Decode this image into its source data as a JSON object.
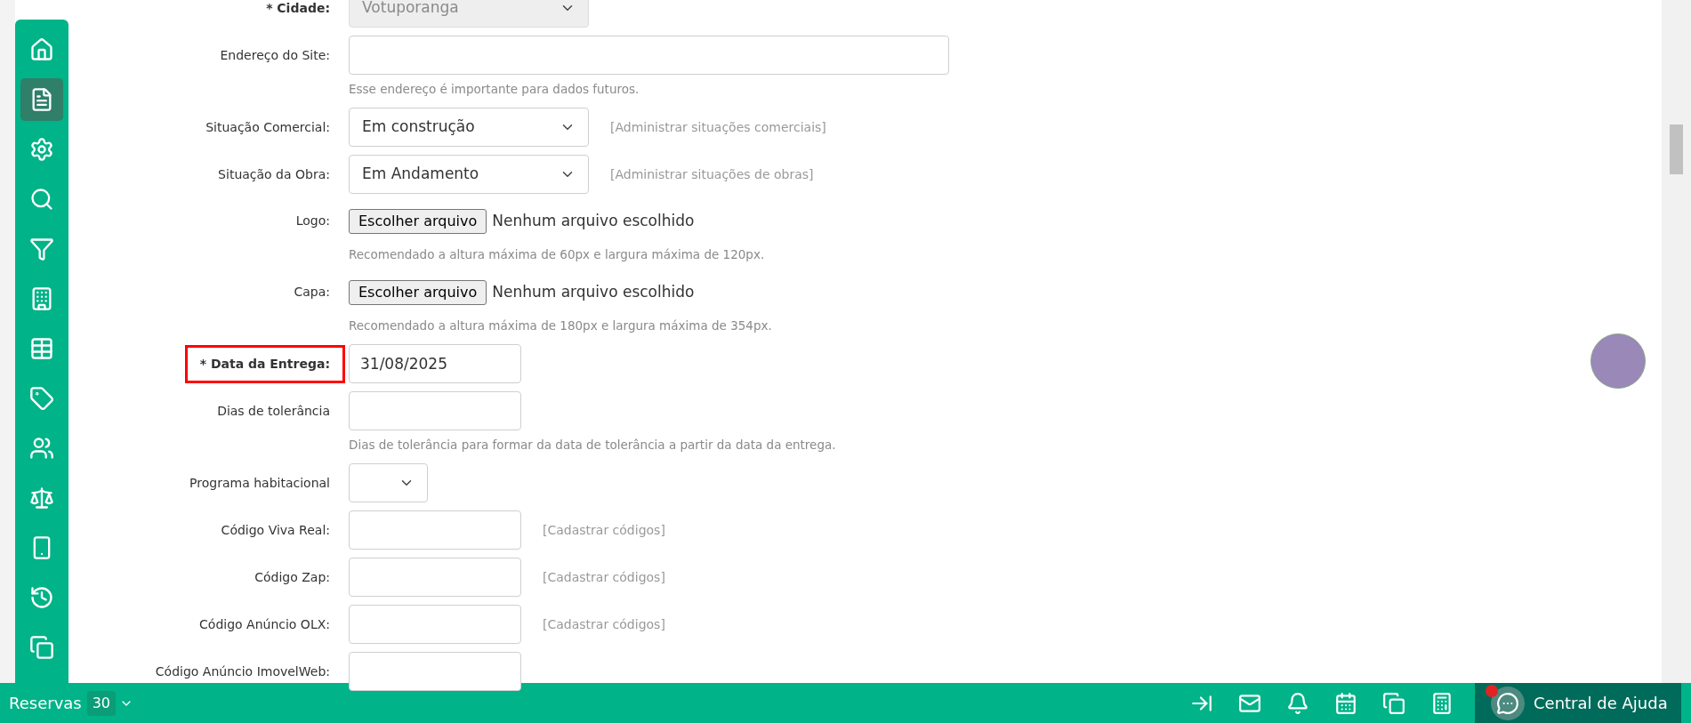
{
  "sidebar": {
    "items": [
      {
        "selected": false
      },
      {
        "selected": true
      },
      {
        "selected": false
      },
      {
        "selected": false
      },
      {
        "selected": false
      },
      {
        "selected": false
      },
      {
        "selected": false
      },
      {
        "selected": false
      },
      {
        "selected": false
      },
      {
        "selected": false
      },
      {
        "selected": false
      },
      {
        "selected": false
      },
      {
        "selected": false
      }
    ]
  },
  "form": {
    "fields": [
      {
        "kind": "select",
        "label": "* Cidade:",
        "required": true,
        "value": "Votuporanga",
        "disabled": true,
        "highlighted": false
      },
      {
        "kind": "text",
        "label": "Endereço do Site:",
        "required": false,
        "hint": "Esse endereço é importante para dados futuros.",
        "highlighted": false
      },
      {
        "kind": "select",
        "label": "Situação Comercial:",
        "required": false,
        "value": "Em construção",
        "disabled": false,
        "link": "[Administrar situações comerciais]",
        "highlighted": false
      },
      {
        "kind": "select",
        "label": "Situação da Obra:",
        "required": false,
        "value": "Em Andamento",
        "disabled": false,
        "link": "[Administrar situações de obras]",
        "highlighted": false
      },
      {
        "kind": "file",
        "label": "Logo:",
        "required": false,
        "button": "Escolher arquivo",
        "status": "Nenhum arquivo escolhido",
        "hint": "Recomendado a altura máxima de 60px e largura máxima de 120px.",
        "highlighted": false
      },
      {
        "kind": "file",
        "label": "Capa:",
        "required": false,
        "button": "Escolher arquivo",
        "status": "Nenhum arquivo escolhido",
        "hint": "Recomendado a altura máxima de 180px e largura máxima de 354px.",
        "highlighted": false
      },
      {
        "kind": "text",
        "label": "* Data da Entrega:",
        "required": true,
        "value": "31/08/2025",
        "highlighted": true
      },
      {
        "kind": "text",
        "label": "Dias de tolerância",
        "required": false,
        "hint": "Dias de tolerância para formar da data de tolerância a partir da data da entrega.",
        "highlighted": false
      },
      {
        "kind": "select",
        "label": "Programa habitacional",
        "required": false,
        "disabled": false,
        "highlighted": false
      },
      {
        "kind": "text",
        "label": "Código Viva Real:",
        "required": false,
        "link": "[Cadastrar códigos]",
        "highlighted": false
      },
      {
        "kind": "text",
        "label": "Código Zap:",
        "required": false,
        "link": "[Cadastrar códigos]",
        "highlighted": false
      },
      {
        "kind": "text",
        "label": "Código Anúncio OLX:",
        "required": false,
        "link": "[Cadastrar códigos]",
        "highlighted": false
      },
      {
        "kind": "text",
        "label": "Código Anúncio ImovelWeb:",
        "required": false,
        "highlighted": false
      }
    ]
  },
  "bottom_bar": {
    "label": "Reservas",
    "count": "30",
    "help": {
      "label": "Central de Ajuda",
      "notification": true
    }
  }
}
